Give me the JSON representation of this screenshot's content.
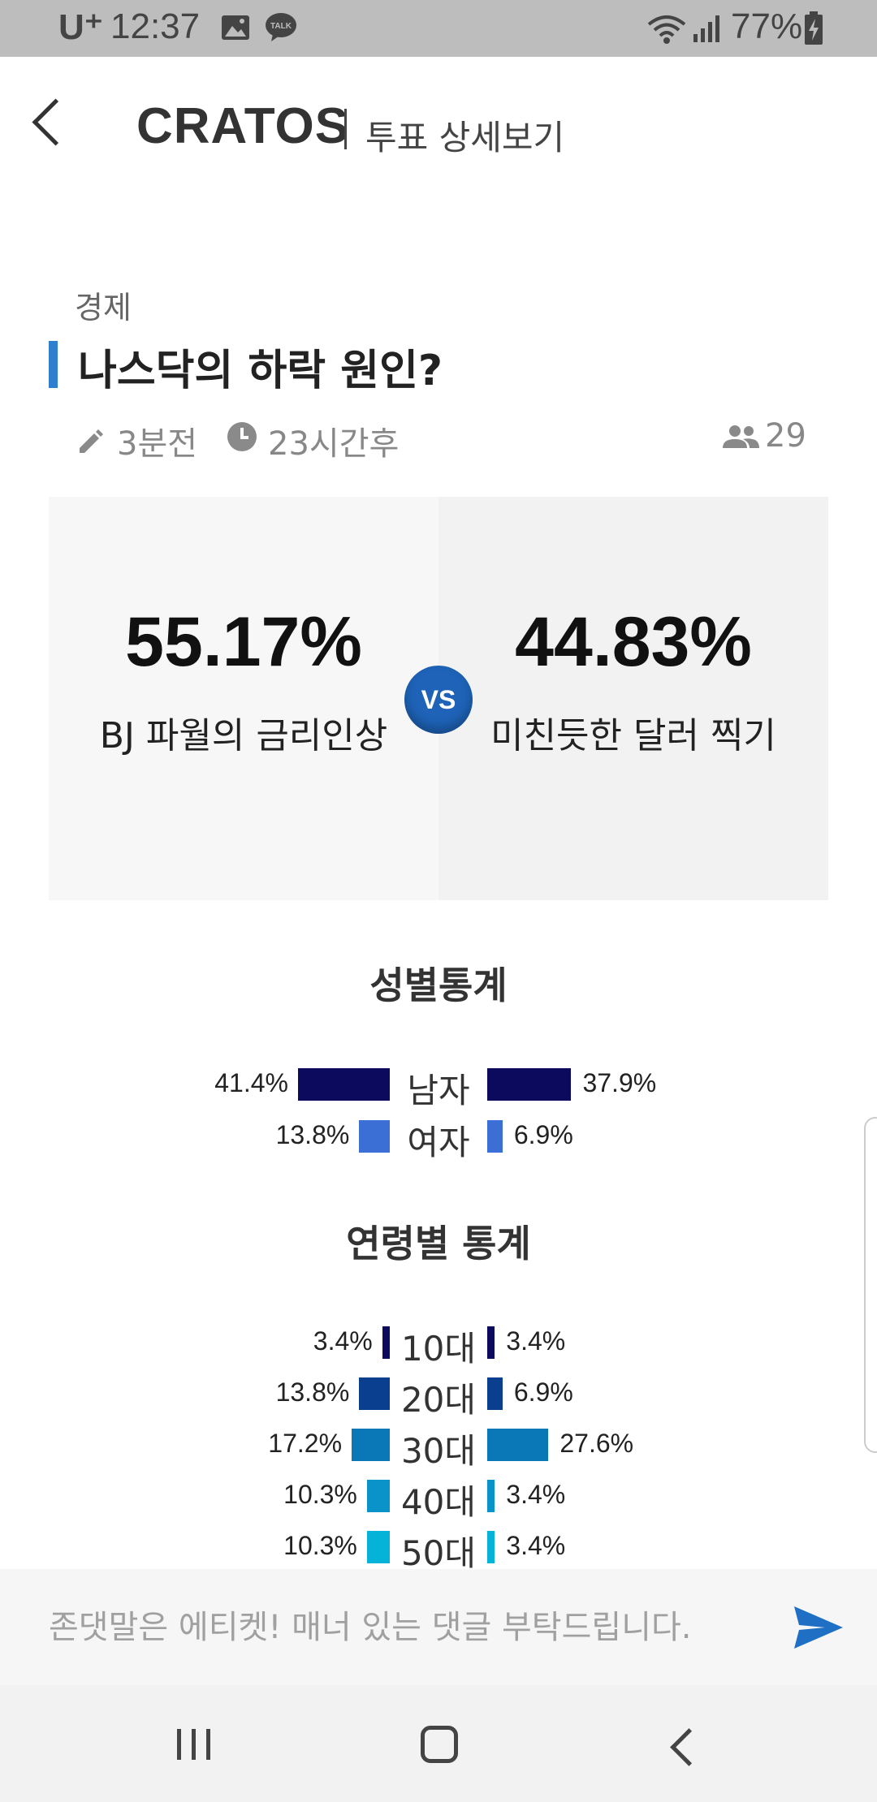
{
  "status_bar": {
    "carrier": "U⁺",
    "time": "12:37",
    "battery": "77%"
  },
  "header": {
    "brand": "CRATOS",
    "page_title": "투표 상세보기"
  },
  "post": {
    "category": "경제",
    "title": "나스닥의 하락 원인?",
    "posted": "3분전",
    "remaining": "23시간후",
    "participants": "29"
  },
  "vote": {
    "left": {
      "percent": "55.17%",
      "option": "BJ 파월의 금리인상"
    },
    "right": {
      "percent": "44.83%",
      "option": "미친듯한 달러 찍기"
    },
    "vs_label": "VS"
  },
  "gender_stats": {
    "title": "성별통계",
    "rows": [
      {
        "label": "남자",
        "left": "41.4%",
        "right": "37.9%",
        "left_value": 41.4,
        "right_value": 37.9,
        "color": "#0b0a5c"
      },
      {
        "label": "여자",
        "left": "13.8%",
        "right": "6.9%",
        "left_value": 13.8,
        "right_value": 6.9,
        "color": "#3b6fd6"
      }
    ]
  },
  "age_stats": {
    "title": "연령별 통계",
    "rows": [
      {
        "label": "10대",
        "left": "3.4%",
        "right": "3.4%",
        "left_value": 3.4,
        "right_value": 3.4,
        "color": "#0b0a5c"
      },
      {
        "label": "20대",
        "left": "13.8%",
        "right": "6.9%",
        "left_value": 13.8,
        "right_value": 6.9,
        "color": "#0a3f8f"
      },
      {
        "label": "30대",
        "left": "17.2%",
        "right": "27.6%",
        "left_value": 17.2,
        "right_value": 27.6,
        "color": "#0a78b6"
      },
      {
        "label": "40대",
        "left": "10.3%",
        "right": "3.4%",
        "left_value": 10.3,
        "right_value": 3.4,
        "color": "#0a93c9"
      },
      {
        "label": "50대",
        "left": "10.3%",
        "right": "3.4%",
        "left_value": 10.3,
        "right_value": 3.4,
        "color": "#06b3d8"
      }
    ]
  },
  "comment": {
    "placeholder": "존댓말은 에티켓! 매너 있는 댓글 부탁드립니다."
  },
  "colors": {
    "accent": "#2f7fd1",
    "vs": "#1e63b8"
  }
}
